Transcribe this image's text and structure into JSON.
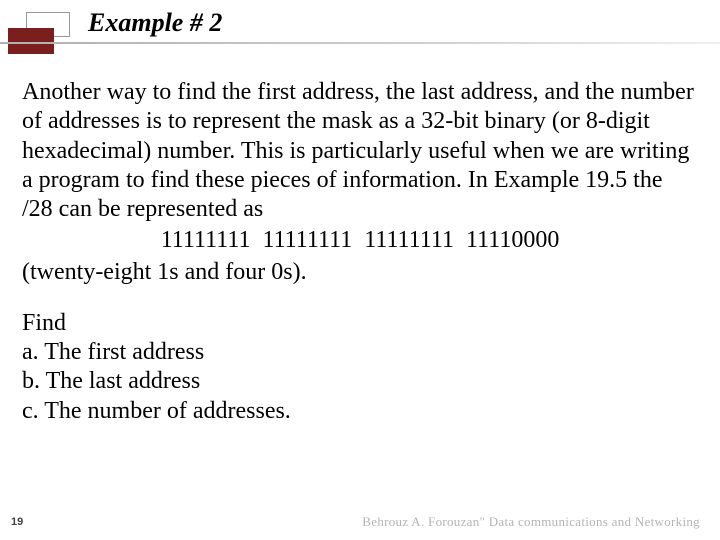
{
  "title": "Example # 2",
  "body": {
    "paragraph": "Another way to find the first address, the last address, and the number of addresses is to represent the mask as a 32-bit binary (or 8-digit hexadecimal) number. This is particularly useful when we are writing a program to find these pieces of information. In Example 19.5 the /28 can be represented as",
    "binary_line": "11111111  11111111  11111111  11110000",
    "paren_line": "(twenty-eight 1s and four 0s).",
    "find_label": "Find",
    "tasks": {
      "a": "a. The first address",
      "b": "b. The last address",
      "c": "c. The number of addresses."
    }
  },
  "page_number": "19",
  "footer": "Behrouz A. Forouzan\" Data communications and Networking"
}
